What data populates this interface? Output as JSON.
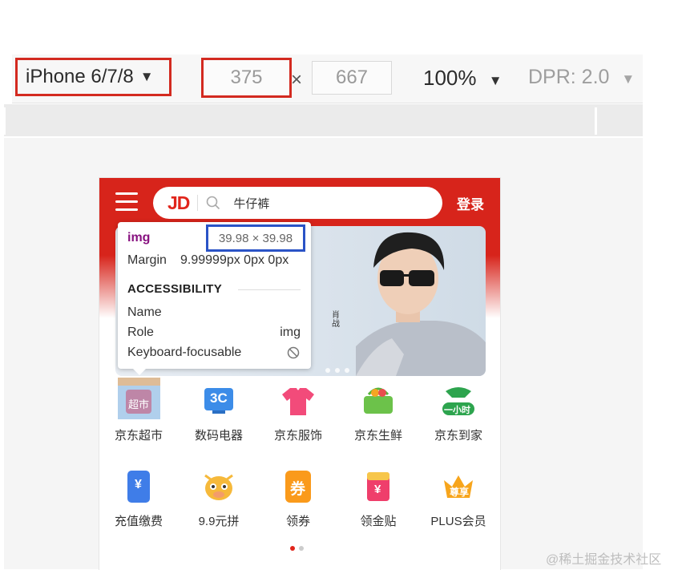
{
  "devtools": {
    "device": "iPhone 6/7/8",
    "width": "375",
    "times": "×",
    "height": "667",
    "zoom": "100%",
    "dpr": "DPR: 2.0"
  },
  "page": {
    "search_placeholder": "牛仔裤",
    "logo": "JD",
    "login": "登录",
    "banner_sign": "肖战",
    "categories_row1": [
      "京东超市",
      "数码电器",
      "京东服饰",
      "京东生鲜",
      "京东到家"
    ],
    "categories_row2": [
      "充值缴费",
      "9.9元拼",
      "领券",
      "领金贴",
      "PLUS会员"
    ],
    "icon_texts": {
      "supermarket": "超市",
      "digital": "3C",
      "delivery": "一小时",
      "recharge": "¥",
      "coupon": "券",
      "subsidy": "¥",
      "plus": "尊享"
    }
  },
  "inspector": {
    "tag": "img",
    "size": "39.98 × 39.98",
    "margin_label": "Margin",
    "margin_value": "9.99999px 0px 0px",
    "section": "ACCESSIBILITY",
    "name_label": "Name",
    "role_label": "Role",
    "role_value": "img",
    "focus_label": "Keyboard-focusable"
  },
  "watermark": "@稀土掘金技术社区",
  "colors": {
    "jd_red": "#d7241b",
    "highlight_border": "#d32a20",
    "size_border": "#2a53c6",
    "tag_purple": "#881280"
  }
}
